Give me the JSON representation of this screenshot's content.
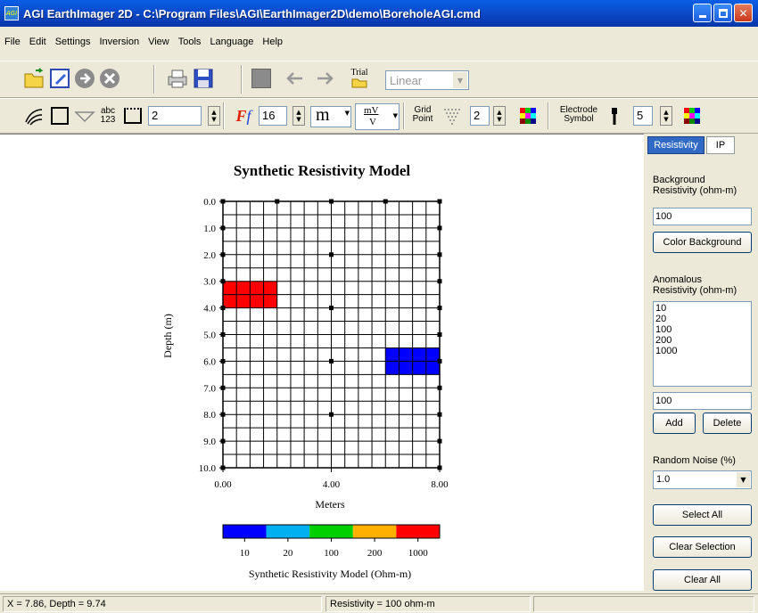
{
  "window": {
    "title": "AGI EarthImager 2D - C:\\Program Files\\AGI\\EarthImager2D\\demo\\BoreholeAGI.cmd",
    "app_icon_text": "AGI"
  },
  "menu": [
    "File",
    "Edit",
    "Settings",
    "Inversion",
    "View",
    "Tools",
    "Language",
    "Help"
  ],
  "toolbar1": {
    "trial_label": "Trial",
    "mode_select": "Linear"
  },
  "toolbar2": {
    "abc_label": "abc",
    "num_label": "123",
    "line_width": "2",
    "font_size": "16",
    "unit_label": "m",
    "mv_top": "mV",
    "mv_bottom": "V",
    "grid_label_1": "Grid",
    "grid_label_2": "Point",
    "grid_size": "2",
    "electrode_label_1": "Electrode",
    "electrode_label_2": "Symbol",
    "electrode_size": "5"
  },
  "plot": {
    "title": "Synthetic Resistivity Model",
    "ylabel": "Depth (m)",
    "xlabel": "Meters",
    "y_ticks": [
      "0.0",
      "1.0",
      "2.0",
      "3.0",
      "4.0",
      "5.0",
      "6.0",
      "7.0",
      "8.0",
      "9.0",
      "10.0"
    ],
    "x_ticks": [
      "0.00",
      "4.00",
      "8.00"
    ],
    "anomalies": [
      {
        "x_from": 0,
        "x_to": 2,
        "depth_from": 3,
        "depth_to": 4,
        "color": "#ff0000"
      },
      {
        "x_from": 6,
        "x_to": 8,
        "depth_from": 5.5,
        "depth_to": 6.5,
        "color": "#0000ff"
      }
    ],
    "colorbar": {
      "colors": [
        "#0000ff",
        "#00b0f0",
        "#00d000",
        "#ffb000",
        "#ff0000"
      ],
      "labels": [
        "10",
        "20",
        "100",
        "200",
        "1000"
      ],
      "title": "Synthetic Resistivity  Model (Ohm-m)"
    }
  },
  "right_panel": {
    "tabs": [
      "Resistivity",
      "IP"
    ],
    "background_label_1": "Background",
    "background_label_2": "Resistivity (ohm-m)",
    "background_value": "100",
    "color_background_button": "Color Background",
    "anomalous_label_1": "Anomalous",
    "anomalous_label_2": "Resistivity (ohm-m)",
    "anomalous_list": [
      "10",
      "20",
      "100",
      "200",
      "1000"
    ],
    "anomalous_value": "100",
    "add_button": "Add",
    "delete_button": "Delete",
    "noise_label": "Random Noise (%)",
    "noise_value": "1.0",
    "select_all_button": "Select All",
    "clear_selection_button": "Clear Selection",
    "clear_all_button": "Clear All"
  },
  "status": {
    "coords": "X = 7.86,  Depth = 9.74",
    "resistivity": "Resistivity = 100 ohm-m"
  },
  "colors": {
    "titlebar": "#0a44c2",
    "chrome": "#ece9d8",
    "tab_selected": "#316ac5"
  }
}
